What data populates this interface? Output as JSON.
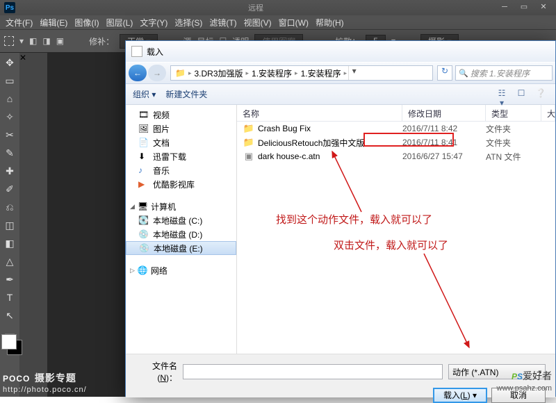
{
  "ps": {
    "title_remote": "远程",
    "menu": [
      "文件(F)",
      "编辑(E)",
      "图像(I)",
      "图层(L)",
      "文字(Y)",
      "选择(S)",
      "滤镜(T)",
      "视图(V)",
      "窗口(W)",
      "帮助(H)"
    ],
    "opt_repair": "修补：",
    "opt_normal": "正常",
    "opt_source": "源",
    "opt_target": "目标",
    "opt_transparent": "透明",
    "opt_usepat": "使用图案",
    "opt_diffuse": "扩散：",
    "opt_diffuse_v": "5",
    "opt_preset": "摄影"
  },
  "dialog": {
    "title": "载入",
    "breadcrumb": [
      "3.DR3加强版",
      "1.安装程序",
      "1.安装程序"
    ],
    "search_ph": "搜索 1.安装程序",
    "toolbar_org": "组织 ▾",
    "toolbar_new": "新建文件夹",
    "sidebar": {
      "video": "视频",
      "pic": "图片",
      "doc": "文档",
      "xunlei": "迅雷下载",
      "music": "音乐",
      "youku": "优酷影视库",
      "computer": "计算机",
      "diskC": "本地磁盘 (C:)",
      "diskD": "本地磁盘 (D:)",
      "diskE": "本地磁盘 (E:)",
      "network": "网络"
    },
    "headers": {
      "name": "名称",
      "date": "修改日期",
      "type": "类型",
      "size": "大"
    },
    "files": [
      {
        "icon": "folder",
        "name": "Crash Bug Fix",
        "date": "2016/7/11 8:42",
        "type": "文件夹"
      },
      {
        "icon": "folder",
        "name": "DeliciousRetouch加强中文版",
        "date": "2016/7/11 8:41",
        "type": "文件夹"
      },
      {
        "icon": "file",
        "name": "dark house-c.atn",
        "date": "2016/6/27 15:47",
        "type": "ATN 文件"
      }
    ],
    "fn_label": "文件名(N)：",
    "filter": "动作 (*.ATN)",
    "btn_load": "载入(L)",
    "btn_cancel": "取消"
  },
  "annot": {
    "line1": "找到这个动作文件，载入就可以了",
    "line2": "双击文件，载入就可以了"
  },
  "wm": {
    "poco": "POCO",
    "poco_sub": "摄影专题",
    "poco_url": "http://photo.poco.cn/",
    "psahz": "PS",
    "psahz2": "爱好者",
    "psahz_url": "www.psahz.com"
  }
}
